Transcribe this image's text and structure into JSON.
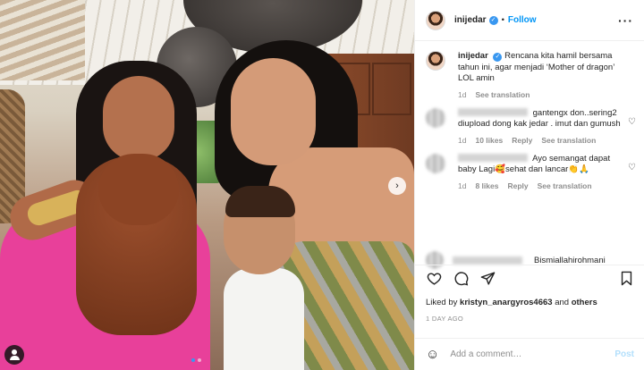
{
  "post": {
    "next_icon": "chevron-right-icon",
    "tag_icon": "user-tag-icon",
    "carousel_dots": 2,
    "carousel_active_index": 1
  },
  "header": {
    "username": "inijedar",
    "separator": "•",
    "follow_label": "Follow",
    "more_icon": "more-horizontal-icon",
    "more_label": "···"
  },
  "caption": {
    "username": "inijedar",
    "text": "Rencana kita hamil bersama tahun ini, agar menjadi ‘Mother of dragon’ LOL amin",
    "time": "1d",
    "translation": "See translation"
  },
  "comments": [
    {
      "text": "gantengx don..sering2 diupload dong kak jedar . imut dan gumush",
      "time": "1d",
      "likes": "10 likes",
      "reply": "Reply",
      "translation": "See translation"
    },
    {
      "text": "Ayo semangat dapat baby Lagi🥰sehat dan lancar👏🙏",
      "time": "1d",
      "likes": "8 likes",
      "reply": "Reply",
      "translation": "See translation"
    }
  ],
  "partial_comment": {
    "text": "Bismiallahirohmani"
  },
  "likes": {
    "prefix": "Liked by",
    "user": "kristyn_anargyros4663",
    "and": "and",
    "others": "others"
  },
  "time_ago": "1 DAY AGO",
  "add_comment": {
    "placeholder": "Add a comment…",
    "post_label": "Post",
    "emoji_icon": "smiley-icon"
  },
  "colors": {
    "accent": "#0095f6",
    "verified": "#3897f0",
    "muted": "#8e8e8e",
    "post_disabled": "#b2dffc"
  }
}
